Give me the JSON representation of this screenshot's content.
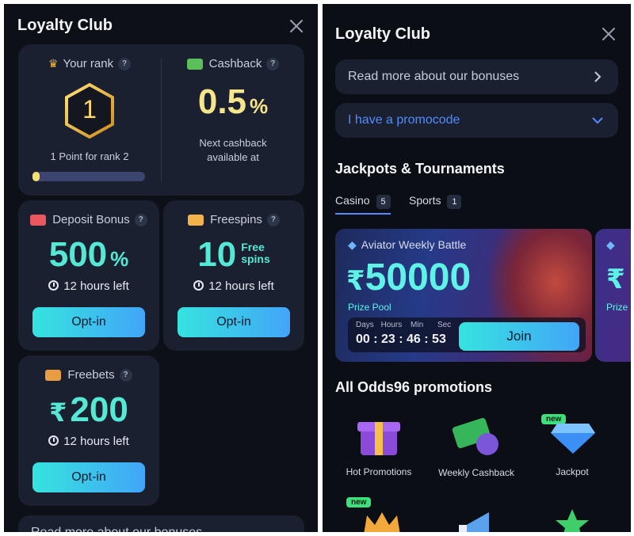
{
  "left": {
    "title": "Loyalty Club",
    "rank": {
      "label": "Your rank",
      "value": "1",
      "caption": "1 Point for rank 2",
      "progress": 0.06
    },
    "cashback": {
      "label": "Cashback",
      "value": "0.5",
      "unit": "%",
      "caption": "Next cashback available at"
    },
    "deposit": {
      "label": "Deposit Bonus",
      "value": "500",
      "unit": "%",
      "timer": "12 hours left",
      "button": "Opt-in"
    },
    "freespins": {
      "label": "Freespins",
      "value": "10",
      "unit_line1": "Free",
      "unit_line2": "spins",
      "timer": "12 hours left",
      "button": "Opt-in"
    },
    "freebets": {
      "label": "Freebets",
      "currency": "₹",
      "value": "200",
      "timer": "12 hours left",
      "button": "Opt-in"
    },
    "read_more": "Read more about our bonuses",
    "qmark": "?"
  },
  "right": {
    "title": "Loyalty Club",
    "read_more": "Read more about our bonuses",
    "promocode": "I have a promocode",
    "jackpots_title": "Jackpots & Tournaments",
    "tabs": [
      {
        "label": "Casino",
        "count": "5"
      },
      {
        "label": "Sports",
        "count": "1"
      }
    ],
    "banner": {
      "name": "Aviator Weekly Battle",
      "currency": "₹",
      "amount": "50000",
      "pool_label": "Prize Pool",
      "countdown_labels": [
        "Days",
        "Hours",
        "Min",
        "Sec"
      ],
      "countdown_values": [
        "00",
        "23",
        "46",
        "53"
      ],
      "button": "Join",
      "next_prize_label": "Prize",
      "next_currency": "₹"
    },
    "promotions_title": "All Odds96 promotions",
    "promotions": [
      {
        "label": "Hot Promotions",
        "badge": ""
      },
      {
        "label": "Weekly Cashback",
        "badge": ""
      },
      {
        "label": "Jackpot",
        "badge": "new"
      }
    ],
    "row2_badge": "new"
  },
  "colors": {
    "accent_cyan": "#34e3d9",
    "accent_blue": "#42a5f8",
    "promo_blue": "#4f8cff",
    "gold": "#f0c040"
  }
}
